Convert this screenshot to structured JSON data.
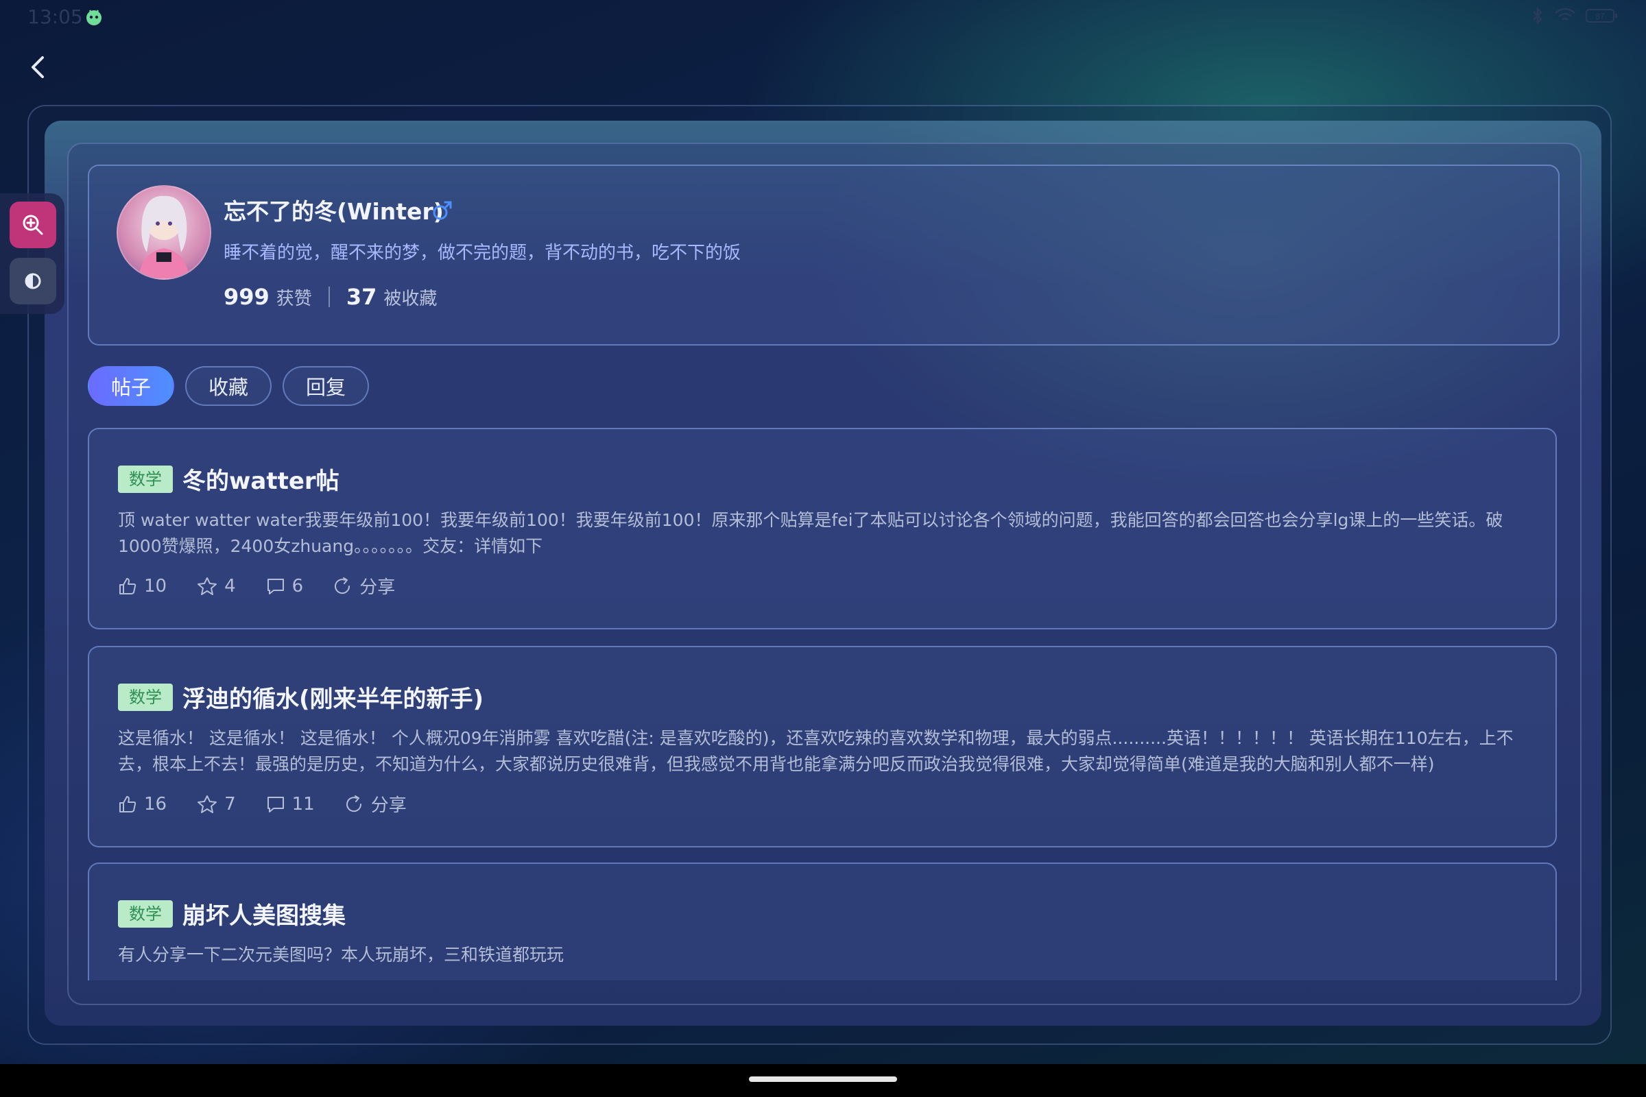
{
  "status_bar": {
    "time": "13:05",
    "battery": "87"
  },
  "profile": {
    "name": "忘不了的冬(Winter)",
    "bio": "睡不着的觉，醒不来的梦，做不完的题，背不动的书，吃不下的饭",
    "likes_count": "999",
    "likes_label": "获赞",
    "favorites_count": "37",
    "favorites_label": "被收藏",
    "gender_icon": "male-icon",
    "accent_color": "#4e8fff"
  },
  "tabs": [
    {
      "label": "帖子",
      "active": true
    },
    {
      "label": "收藏",
      "active": false
    },
    {
      "label": "回复",
      "active": false
    }
  ],
  "posts": [
    {
      "tag": "数学",
      "title": "冬的watter帖",
      "body": "顶 water watter water我要年级前100！我要年级前100！我要年级前100！原来那个贴算是fei了本贴可以讨论各个领域的问题，我能回答的都会回答也会分享lg课上的一些笑话。破1000赞爆照，2400女zhuang。。。。。。。交友：详情如下",
      "likes": "10",
      "stars": "4",
      "comments": "6",
      "share_label": "分享"
    },
    {
      "tag": "数学",
      "title": "浮迪的循水(刚来半年的新手)",
      "body": "这是循水！   这是循水！   这是循水！             个人概况09年消肺雾 喜欢吃醋(注: 是喜欢吃酸的)，还喜欢吃辣的喜欢数学和物理，最大的弱点..........英语！！！！！！ 英语长期在110左右，上不去，根本上不去！最强的是历史，不知道为什么，大家都说历史很难背，但我感觉不用背也能拿满分吧反而政治我觉得很难，大家却觉得简单(难道是我的大脑和别人都不一样)",
      "likes": "16",
      "stars": "7",
      "comments": "11",
      "share_label": "分享"
    },
    {
      "tag": "数学",
      "title": "崩坏人美图搜集",
      "body": "有人分享一下二次元美图吗？本人玩崩坏，三和铁道都玩玩"
    }
  ]
}
